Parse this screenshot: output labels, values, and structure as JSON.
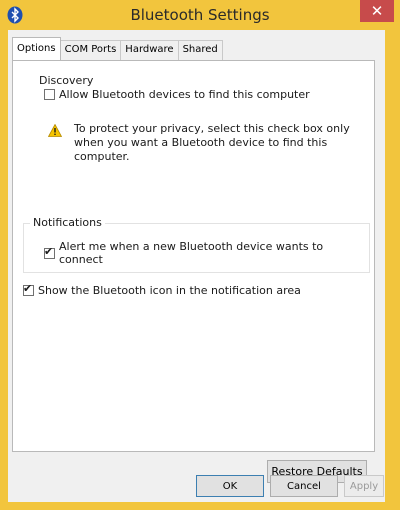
{
  "window": {
    "title": "Bluetooth Settings",
    "close_label": "✕"
  },
  "tabs": [
    {
      "label": "Options",
      "active": true
    },
    {
      "label": "COM Ports",
      "active": false
    },
    {
      "label": "Hardware",
      "active": false
    },
    {
      "label": "Shared",
      "active": false
    }
  ],
  "discovery": {
    "group_title": "Discovery",
    "allow_label": "Allow Bluetooth devices to find this computer",
    "allow_checked": false,
    "warning_line1": "To protect your privacy, select this check box only",
    "warning_line2": "when you want a Bluetooth device to find this",
    "warning_line3": "computer."
  },
  "notifications": {
    "group_title": "Notifications",
    "alert_label": "Alert me when a new Bluetooth device wants to connect",
    "alert_checked": true
  },
  "show_icon": {
    "label": "Show the Bluetooth icon in the notification area",
    "checked": true
  },
  "buttons": {
    "restore_defaults": "Restore Defaults",
    "ok": "OK",
    "cancel": "Cancel",
    "apply": "Apply"
  },
  "check_mark": "✔",
  "colors": {
    "title_bar": "#f2c53d",
    "close_button": "#c74b4b",
    "bluetooth_blue": "#1f4fb0",
    "warning_yellow": "#f5c400"
  }
}
